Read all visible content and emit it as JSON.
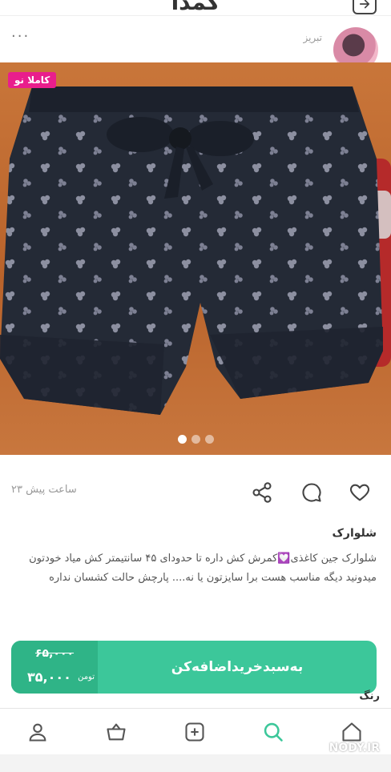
{
  "header": {
    "title": "کمدا",
    "share_icon": "share-exit-icon"
  },
  "seller": {
    "city": "تبریز",
    "more_icon": "more-dots-icon",
    "more_text": "..."
  },
  "product": {
    "badge": "کاملا نو",
    "image_alt": "dark navy floral shorts on orange fabric",
    "slides": 3,
    "active_slide": 1
  },
  "actions": {
    "time_ago": "۲۳ ساعت پیش",
    "icons": [
      "share-icon",
      "comment-icon",
      "heart-icon"
    ]
  },
  "description": {
    "title": "شلوارک",
    "body": "شلوارک جین کاغذی💟کمرش کش داره تا حدودای ۴۵ سانتیمتر کش میاد خودتون میدونید دیگه مناسب هست برا سایزتون یا نه.... پارچش حالت کشسان نداره"
  },
  "cart": {
    "add_label": "به‌سبدخریداضافه‌کن",
    "old_price": "۶۵,۰۰۰",
    "new_price": "۳۵,۰۰۰",
    "currency": "تومن",
    "color_label": "رنگ"
  },
  "bottom_nav": {
    "items": [
      "profile-icon",
      "basket-icon",
      "add-icon",
      "search-icon",
      "home-icon"
    ]
  },
  "watermark": "NODY.IR",
  "colors": {
    "primary": "#3cc79a",
    "primary_dark": "#2fb487",
    "badge": "#e91e8c"
  }
}
